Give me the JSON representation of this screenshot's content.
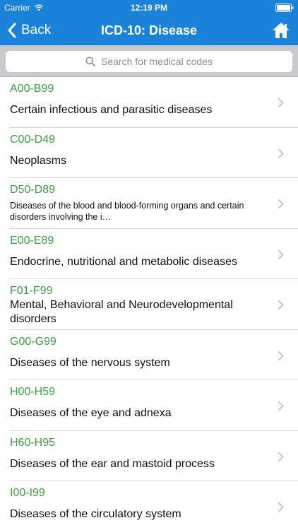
{
  "status": {
    "carrier": "Carrier",
    "time": "12:19 PM"
  },
  "nav": {
    "back_label": "Back",
    "title": "ICD-10: Disease"
  },
  "search": {
    "placeholder": "Search for medical codes"
  },
  "items": [
    {
      "code": "A00-B99",
      "title": "Certain infectious and parasitic diseases",
      "small": false
    },
    {
      "code": "C00-D49",
      "title": "Neoplasms",
      "small": false
    },
    {
      "code": "D50-D89",
      "title": "Diseases of the blood and blood-forming organs and certain disorders involving the i…",
      "small": true
    },
    {
      "code": "E00-E89",
      "title": "Endocrine, nutritional and metabolic diseases",
      "small": false
    },
    {
      "code": "F01-F99",
      "title": "Mental, Behavioral and Neurodevelopmental disorders",
      "small": false
    },
    {
      "code": "G00-G99",
      "title": "Diseases of the nervous system",
      "small": false
    },
    {
      "code": "H00-H59",
      "title": "Diseases of the eye and adnexa",
      "small": false
    },
    {
      "code": "H60-H95",
      "title": "Diseases of the ear and mastoid process",
      "small": false
    },
    {
      "code": "I00-I99",
      "title": "Diseases of the circulatory system",
      "small": false
    }
  ],
  "colors": {
    "nav_background": "#1a82d8",
    "code_green": "#3aa33f"
  },
  "icons": {
    "back": "chevron-left-icon",
    "home": "home-icon",
    "search": "magnifier-icon",
    "row": "chevron-right-icon"
  }
}
